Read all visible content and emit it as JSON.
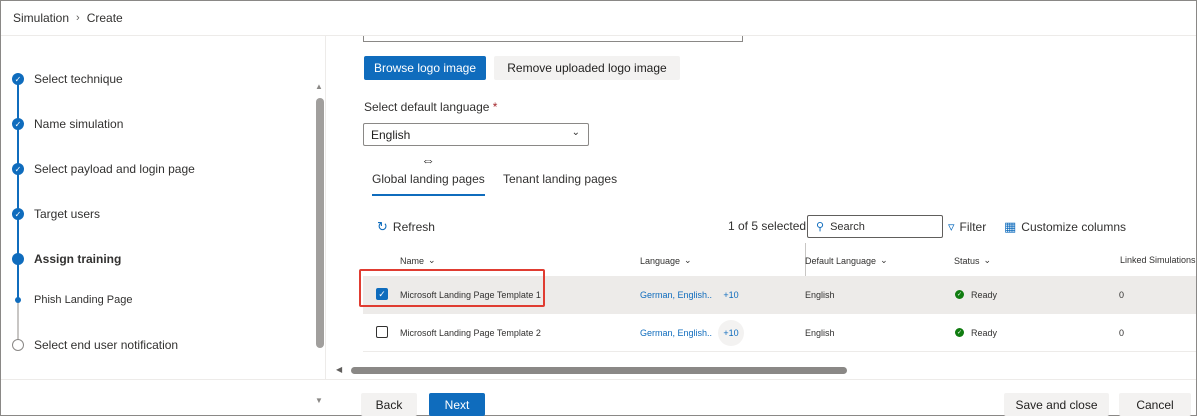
{
  "breadcrumb": {
    "root": "Simulation",
    "current": "Create"
  },
  "steps": [
    {
      "label": "Select technique",
      "state": "done"
    },
    {
      "label": "Name simulation",
      "state": "done"
    },
    {
      "label": "Select payload and login page",
      "state": "done"
    },
    {
      "label": "Target users",
      "state": "done"
    },
    {
      "label": "Assign training",
      "state": "current"
    },
    {
      "label": "Phish Landing Page",
      "state": "substep"
    },
    {
      "label": "Select end user notification",
      "state": "pending"
    }
  ],
  "logo": {
    "browse_label": "Browse logo image",
    "remove_label": "Remove uploaded logo image"
  },
  "language": {
    "label": "Select default language",
    "required": "*",
    "value": "English"
  },
  "tabs": [
    {
      "label": "Global landing pages",
      "active": true
    },
    {
      "label": "Tenant landing pages",
      "active": false
    }
  ],
  "toolbar": {
    "refresh_label": "Refresh",
    "selection_count": "1 of 5 selected",
    "search_placeholder": "Search",
    "filter_label": "Filter",
    "customize_label": "Customize columns"
  },
  "columns": {
    "name": "Name",
    "language": "Language",
    "default_language": "Default Language",
    "status": "Status",
    "linked": "Linked Simulations"
  },
  "rows": [
    {
      "name": "Microsoft Landing Page Template 1",
      "language": "German, English..",
      "more": "+10",
      "default_language": "English",
      "status": "Ready",
      "linked": "0",
      "checked": true
    },
    {
      "name": "Microsoft Landing Page Template 2",
      "language": "German, English..",
      "more": "+10",
      "default_language": "English",
      "status": "Ready",
      "linked": "0",
      "checked": false
    }
  ],
  "footer": {
    "back": "Back",
    "next": "Next",
    "save_close": "Save and close",
    "cancel": "Cancel"
  },
  "colors": {
    "accent": "#0f6cbd",
    "highlight": "#e03c31",
    "ready": "#107c10"
  }
}
